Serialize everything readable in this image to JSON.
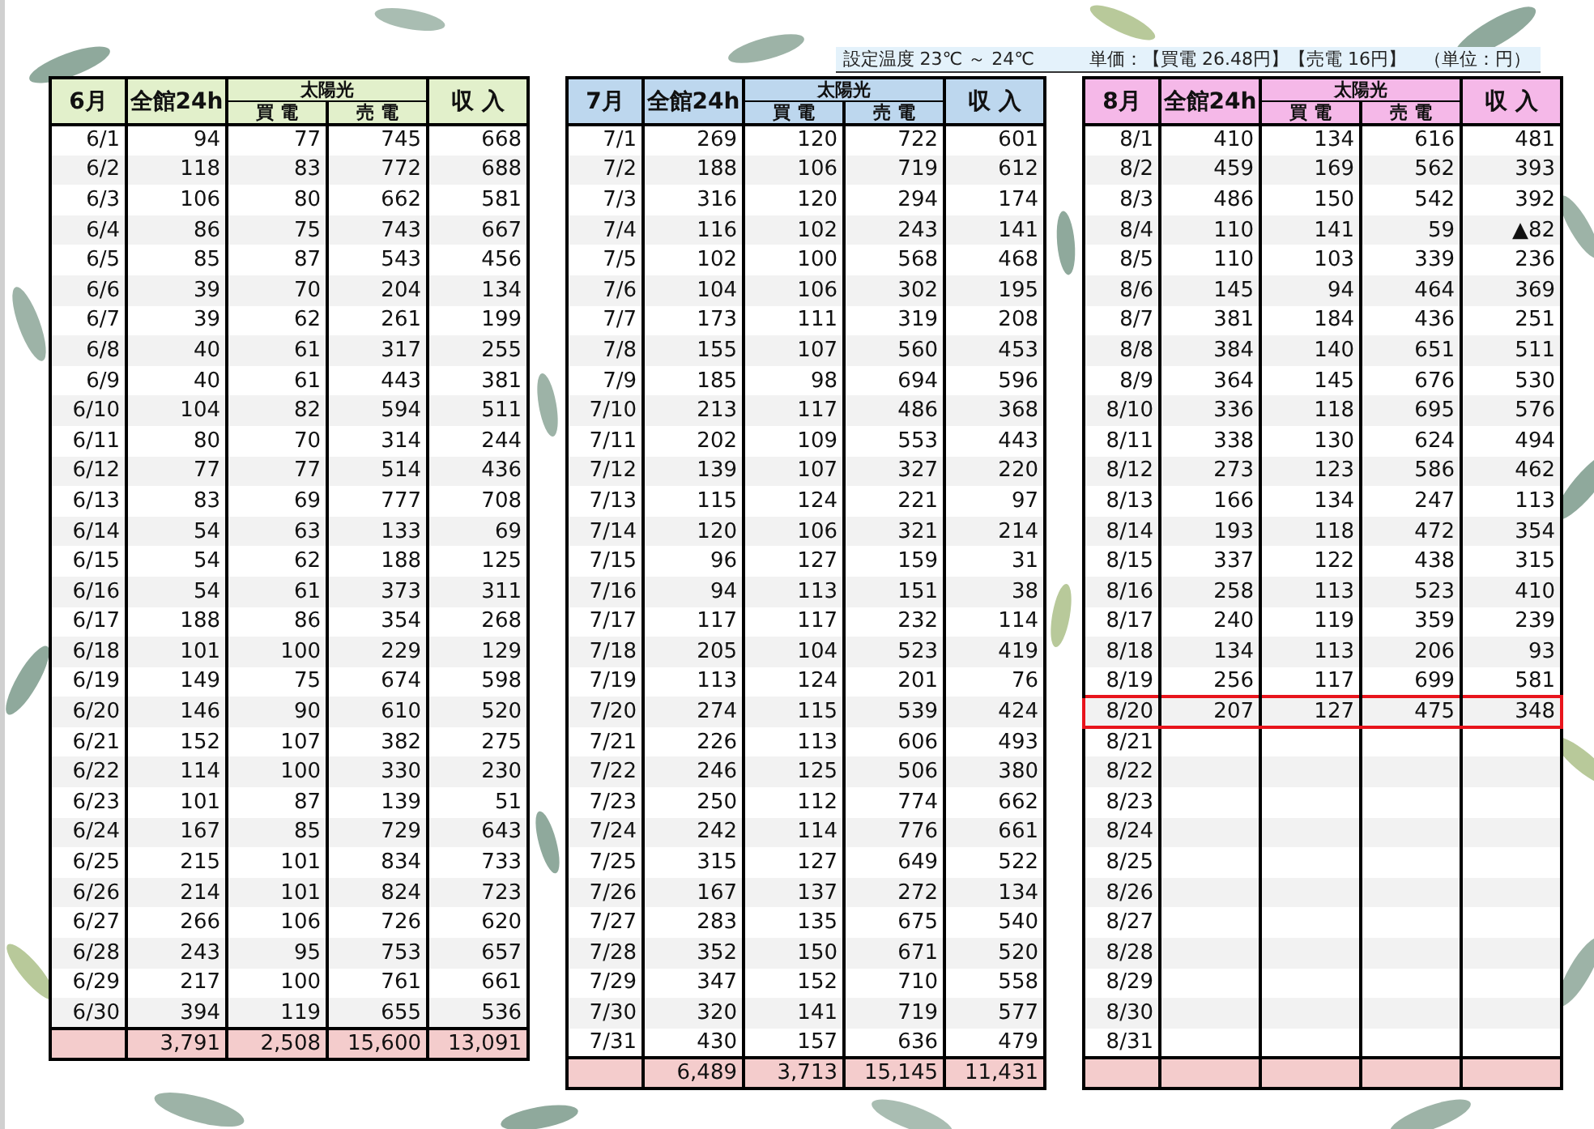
{
  "note": {
    "temperature": "設定温度 23℃ ～ 24℃",
    "price": "単価：【買電 26.48円】【売電 16円】　（単位：円）"
  },
  "tables": [
    {
      "month": "6月",
      "color": "#e2f0cb",
      "columns": {
        "total": "全館24h",
        "solar": "太陽光",
        "buy": "買 電",
        "sell": "売 電",
        "income": "収 入"
      },
      "rows": [
        {
          "date": "6/1",
          "cells": [
            "94",
            "77",
            "745",
            "668"
          ]
        },
        {
          "date": "6/2",
          "cells": [
            "118",
            "83",
            "772",
            "688"
          ]
        },
        {
          "date": "6/3",
          "cells": [
            "106",
            "80",
            "662",
            "581"
          ]
        },
        {
          "date": "6/4",
          "cells": [
            "86",
            "75",
            "743",
            "667"
          ]
        },
        {
          "date": "6/5",
          "cells": [
            "85",
            "87",
            "543",
            "456"
          ]
        },
        {
          "date": "6/6",
          "cells": [
            "39",
            "70",
            "204",
            "134"
          ]
        },
        {
          "date": "6/7",
          "cells": [
            "39",
            "62",
            "261",
            "199"
          ]
        },
        {
          "date": "6/8",
          "cells": [
            "40",
            "61",
            "317",
            "255"
          ]
        },
        {
          "date": "6/9",
          "cells": [
            "40",
            "61",
            "443",
            "381"
          ]
        },
        {
          "date": "6/10",
          "cells": [
            "104",
            "82",
            "594",
            "511"
          ]
        },
        {
          "date": "6/11",
          "cells": [
            "80",
            "70",
            "314",
            "244"
          ]
        },
        {
          "date": "6/12",
          "cells": [
            "77",
            "77",
            "514",
            "436"
          ]
        },
        {
          "date": "6/13",
          "cells": [
            "83",
            "69",
            "777",
            "708"
          ]
        },
        {
          "date": "6/14",
          "cells": [
            "54",
            "63",
            "133",
            "69"
          ]
        },
        {
          "date": "6/15",
          "cells": [
            "54",
            "62",
            "188",
            "125"
          ]
        },
        {
          "date": "6/16",
          "cells": [
            "54",
            "61",
            "373",
            "311"
          ]
        },
        {
          "date": "6/17",
          "cells": [
            "188",
            "86",
            "354",
            "268"
          ]
        },
        {
          "date": "6/18",
          "cells": [
            "101",
            "100",
            "229",
            "129"
          ]
        },
        {
          "date": "6/19",
          "cells": [
            "149",
            "75",
            "674",
            "598"
          ]
        },
        {
          "date": "6/20",
          "cells": [
            "146",
            "90",
            "610",
            "520"
          ]
        },
        {
          "date": "6/21",
          "cells": [
            "152",
            "107",
            "382",
            "275"
          ]
        },
        {
          "date": "6/22",
          "cells": [
            "114",
            "100",
            "330",
            "230"
          ]
        },
        {
          "date": "6/23",
          "cells": [
            "101",
            "87",
            "139",
            "51"
          ]
        },
        {
          "date": "6/24",
          "cells": [
            "167",
            "85",
            "729",
            "643"
          ]
        },
        {
          "date": "6/25",
          "cells": [
            "215",
            "101",
            "834",
            "733"
          ]
        },
        {
          "date": "6/26",
          "cells": [
            "214",
            "101",
            "824",
            "723"
          ]
        },
        {
          "date": "6/27",
          "cells": [
            "266",
            "106",
            "726",
            "620"
          ]
        },
        {
          "date": "6/28",
          "cells": [
            "243",
            "95",
            "753",
            "657"
          ]
        },
        {
          "date": "6/29",
          "cells": [
            "217",
            "100",
            "761",
            "661"
          ]
        },
        {
          "date": "6/30",
          "cells": [
            "394",
            "119",
            "655",
            "536"
          ]
        }
      ],
      "totals": [
        "3,791",
        "2,508",
        "15,600",
        "13,091"
      ]
    },
    {
      "month": "7月",
      "color": "#bdd7ee",
      "columns": {
        "total": "全館24h",
        "solar": "太陽光",
        "buy": "買 電",
        "sell": "売 電",
        "income": "収 入"
      },
      "rows": [
        {
          "date": "7/1",
          "cells": [
            "269",
            "120",
            "722",
            "601"
          ]
        },
        {
          "date": "7/2",
          "cells": [
            "188",
            "106",
            "719",
            "612"
          ]
        },
        {
          "date": "7/3",
          "cells": [
            "316",
            "120",
            "294",
            "174"
          ]
        },
        {
          "date": "7/4",
          "cells": [
            "116",
            "102",
            "243",
            "141"
          ]
        },
        {
          "date": "7/5",
          "cells": [
            "102",
            "100",
            "568",
            "468"
          ]
        },
        {
          "date": "7/6",
          "cells": [
            "104",
            "106",
            "302",
            "195"
          ]
        },
        {
          "date": "7/7",
          "cells": [
            "173",
            "111",
            "319",
            "208"
          ]
        },
        {
          "date": "7/8",
          "cells": [
            "155",
            "107",
            "560",
            "453"
          ]
        },
        {
          "date": "7/9",
          "cells": [
            "185",
            "98",
            "694",
            "596"
          ]
        },
        {
          "date": "7/10",
          "cells": [
            "213",
            "117",
            "486",
            "368"
          ]
        },
        {
          "date": "7/11",
          "cells": [
            "202",
            "109",
            "553",
            "443"
          ]
        },
        {
          "date": "7/12",
          "cells": [
            "139",
            "107",
            "327",
            "220"
          ]
        },
        {
          "date": "7/13",
          "cells": [
            "115",
            "124",
            "221",
            "97"
          ]
        },
        {
          "date": "7/14",
          "cells": [
            "120",
            "106",
            "321",
            "214"
          ]
        },
        {
          "date": "7/15",
          "cells": [
            "96",
            "127",
            "159",
            "31"
          ]
        },
        {
          "date": "7/16",
          "cells": [
            "94",
            "113",
            "151",
            "38"
          ]
        },
        {
          "date": "7/17",
          "cells": [
            "117",
            "117",
            "232",
            "114"
          ]
        },
        {
          "date": "7/18",
          "cells": [
            "205",
            "104",
            "523",
            "419"
          ]
        },
        {
          "date": "7/19",
          "cells": [
            "113",
            "124",
            "201",
            "76"
          ]
        },
        {
          "date": "7/20",
          "cells": [
            "274",
            "115",
            "539",
            "424"
          ]
        },
        {
          "date": "7/21",
          "cells": [
            "226",
            "113",
            "606",
            "493"
          ]
        },
        {
          "date": "7/22",
          "cells": [
            "246",
            "125",
            "506",
            "380"
          ]
        },
        {
          "date": "7/23",
          "cells": [
            "250",
            "112",
            "774",
            "662"
          ]
        },
        {
          "date": "7/24",
          "cells": [
            "242",
            "114",
            "776",
            "661"
          ]
        },
        {
          "date": "7/25",
          "cells": [
            "315",
            "127",
            "649",
            "522"
          ]
        },
        {
          "date": "7/26",
          "cells": [
            "167",
            "137",
            "272",
            "134"
          ]
        },
        {
          "date": "7/27",
          "cells": [
            "283",
            "135",
            "675",
            "540"
          ]
        },
        {
          "date": "7/28",
          "cells": [
            "352",
            "150",
            "671",
            "520"
          ]
        },
        {
          "date": "7/29",
          "cells": [
            "347",
            "152",
            "710",
            "558"
          ]
        },
        {
          "date": "7/30",
          "cells": [
            "320",
            "141",
            "719",
            "577"
          ]
        },
        {
          "date": "7/31",
          "cells": [
            "430",
            "157",
            "636",
            "479"
          ]
        }
      ],
      "totals": [
        "6,489",
        "3,713",
        "15,145",
        "11,431"
      ]
    },
    {
      "month": "8月",
      "color": "#f5b8e8",
      "columns": {
        "total": "全館24h",
        "solar": "太陽光",
        "buy": "買 電",
        "sell": "売 電",
        "income": "収 入"
      },
      "rows": [
        {
          "date": "8/1",
          "cells": [
            "410",
            "134",
            "616",
            "481"
          ],
          "highlighted": false
        },
        {
          "date": "8/2",
          "cells": [
            "459",
            "169",
            "562",
            "393"
          ],
          "highlighted": false
        },
        {
          "date": "8/3",
          "cells": [
            "486",
            "150",
            "542",
            "392"
          ],
          "highlighted": false
        },
        {
          "date": "8/4",
          "cells": [
            "110",
            "141",
            "59",
            "▲82"
          ],
          "highlighted": false
        },
        {
          "date": "8/5",
          "cells": [
            "110",
            "103",
            "339",
            "236"
          ],
          "highlighted": false
        },
        {
          "date": "8/6",
          "cells": [
            "145",
            "94",
            "464",
            "369"
          ],
          "highlighted": false
        },
        {
          "date": "8/7",
          "cells": [
            "381",
            "184",
            "436",
            "251"
          ],
          "highlighted": false
        },
        {
          "date": "8/8",
          "cells": [
            "384",
            "140",
            "651",
            "511"
          ],
          "highlighted": false
        },
        {
          "date": "8/9",
          "cells": [
            "364",
            "145",
            "676",
            "530"
          ],
          "highlighted": false
        },
        {
          "date": "8/10",
          "cells": [
            "336",
            "118",
            "695",
            "576"
          ],
          "highlighted": false
        },
        {
          "date": "8/11",
          "cells": [
            "338",
            "130",
            "624",
            "494"
          ],
          "highlighted": false
        },
        {
          "date": "8/12",
          "cells": [
            "273",
            "123",
            "586",
            "462"
          ],
          "highlighted": false
        },
        {
          "date": "8/13",
          "cells": [
            "166",
            "134",
            "247",
            "113"
          ],
          "highlighted": false
        },
        {
          "date": "8/14",
          "cells": [
            "193",
            "118",
            "472",
            "354"
          ],
          "highlighted": false
        },
        {
          "date": "8/15",
          "cells": [
            "337",
            "122",
            "438",
            "315"
          ],
          "highlighted": false
        },
        {
          "date": "8/16",
          "cells": [
            "258",
            "113",
            "523",
            "410"
          ],
          "highlighted": false
        },
        {
          "date": "8/17",
          "cells": [
            "240",
            "119",
            "359",
            "239"
          ],
          "highlighted": false
        },
        {
          "date": "8/18",
          "cells": [
            "134",
            "113",
            "206",
            "93"
          ],
          "highlighted": false
        },
        {
          "date": "8/19",
          "cells": [
            "256",
            "117",
            "699",
            "581"
          ],
          "highlighted": false
        },
        {
          "date": "8/20",
          "cells": [
            "207",
            "127",
            "475",
            "348"
          ],
          "highlighted": true
        },
        {
          "date": "8/21",
          "highlighted": false
        },
        {
          "date": "8/22",
          "highlighted": false
        },
        {
          "date": "8/23",
          "highlighted": false
        },
        {
          "date": "8/24",
          "highlighted": false
        },
        {
          "date": "8/25",
          "highlighted": false
        },
        {
          "date": "8/26",
          "highlighted": false
        },
        {
          "date": "8/27",
          "highlighted": false
        },
        {
          "date": "8/28",
          "highlighted": false
        },
        {
          "date": "8/29",
          "highlighted": false
        },
        {
          "date": "8/30",
          "highlighted": false
        },
        {
          "date": "8/31",
          "highlighted": false
        }
      ]
    }
  ]
}
